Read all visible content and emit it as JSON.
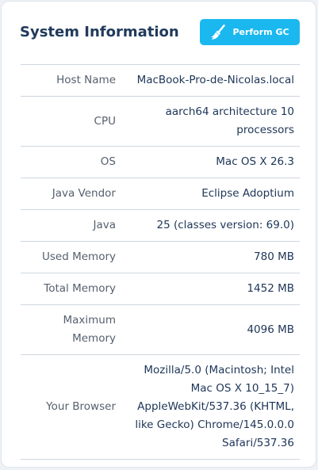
{
  "panel": {
    "title": "System Information",
    "gc_button_label": "Perform GC",
    "gc_button_icon": "broom-icon"
  },
  "rows": [
    {
      "key": "Host Name",
      "value": "MacBook-Pro-de-Nicolas.local"
    },
    {
      "key": "CPU",
      "value": "aarch64 architecture 10 processors"
    },
    {
      "key": "OS",
      "value": "Mac OS X 26.3"
    },
    {
      "key": "Java Vendor",
      "value": "Eclipse Adoptium"
    },
    {
      "key": "Java",
      "value": "25 (classes version: 69.0)"
    },
    {
      "key": "Used Memory",
      "value": "780 MB"
    },
    {
      "key": "Total Memory",
      "value": "1452 MB"
    },
    {
      "key": "Maximum Memory",
      "value": "4096 MB"
    },
    {
      "key": "Your Browser",
      "value": "Mozilla/5.0 (Macintosh; Intel Mac OS X 10_15_7) AppleWebKit/537.36 (KHTML, like Gecko) Chrome/145.0.0.0 Safari/537.36"
    }
  ],
  "colors": {
    "accent": "#1ab8ef",
    "title": "#213a5c",
    "key_text": "#55606e",
    "value_text": "#1d3557"
  }
}
